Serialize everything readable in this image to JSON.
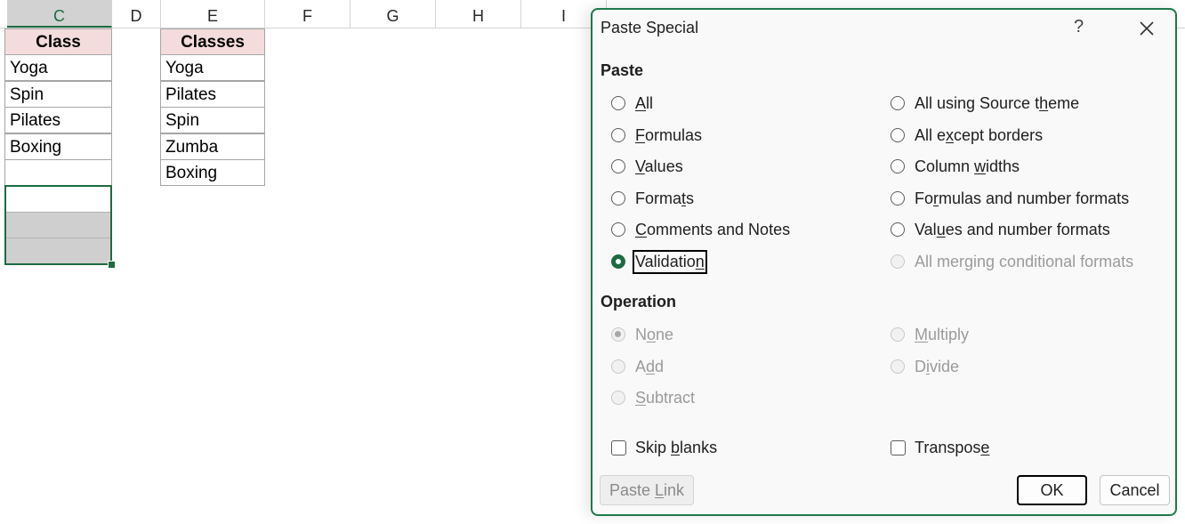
{
  "sheet": {
    "columns": [
      {
        "label": "C",
        "selected": true
      },
      {
        "label": "D",
        "selected": false
      },
      {
        "label": "E",
        "selected": false
      },
      {
        "label": "F",
        "selected": false
      },
      {
        "label": "G",
        "selected": false
      },
      {
        "label": "H",
        "selected": false
      },
      {
        "label": "I",
        "selected": false
      }
    ],
    "class_list": {
      "header": "Class",
      "items": [
        "Yoga",
        "Spin",
        "Pilates",
        "Boxing"
      ]
    },
    "classes_list": {
      "header": "Classes",
      "items": [
        "Yoga",
        "Pilates",
        "Spin",
        "Zumba",
        "Boxing"
      ]
    },
    "accent_color": "#1e6b41"
  },
  "dialog": {
    "title": "Paste Special",
    "help": "?",
    "paste_label": "Paste",
    "paste_options_left": [
      {
        "pre": "",
        "ul": "A",
        "post": "ll",
        "checked": false,
        "disabled": false
      },
      {
        "pre": "",
        "ul": "F",
        "post": "ormulas",
        "checked": false,
        "disabled": false
      },
      {
        "pre": "",
        "ul": "V",
        "post": "alues",
        "checked": false,
        "disabled": false
      },
      {
        "pre": "Forma",
        "ul": "t",
        "post": "s",
        "checked": false,
        "disabled": false
      },
      {
        "pre": "",
        "ul": "C",
        "post": "omments and Notes",
        "checked": false,
        "disabled": false
      },
      {
        "pre": "Validatio",
        "ul": "n",
        "post": "",
        "checked": true,
        "disabled": false
      }
    ],
    "paste_options_right": [
      {
        "pre": "All using Source t",
        "ul": "h",
        "post": "eme",
        "checked": false,
        "disabled": false
      },
      {
        "pre": "All e",
        "ul": "x",
        "post": "cept borders",
        "checked": false,
        "disabled": false
      },
      {
        "pre": "Column ",
        "ul": "w",
        "post": "idths",
        "checked": false,
        "disabled": false
      },
      {
        "pre": "Fo",
        "ul": "r",
        "post": "mulas and number formats",
        "checked": false,
        "disabled": false
      },
      {
        "pre": "Val",
        "ul": "u",
        "post": "es and number formats",
        "checked": false,
        "disabled": false
      },
      {
        "pre": "All mer",
        "ul": "g",
        "post": "ing conditional formats",
        "checked": false,
        "disabled": true
      }
    ],
    "operation_label": "Operation",
    "operation_left": [
      {
        "pre": "N",
        "ul": "o",
        "post": "ne",
        "checked": true,
        "disabled": true
      },
      {
        "pre": "A",
        "ul": "d",
        "post": "d",
        "checked": false,
        "disabled": true
      },
      {
        "pre": "",
        "ul": "S",
        "post": "ubtract",
        "checked": false,
        "disabled": true
      }
    ],
    "operation_right": [
      {
        "pre": "",
        "ul": "M",
        "post": "ultiply",
        "checked": false,
        "disabled": true
      },
      {
        "pre": "D",
        "ul": "i",
        "post": "vide",
        "checked": false,
        "disabled": true
      }
    ],
    "skip_blanks": {
      "pre": "Skip ",
      "ul": "b",
      "post": "lanks",
      "checked": false
    },
    "transpose": {
      "pre": "Transpos",
      "ul": "e",
      "post": "",
      "checked": false
    },
    "paste_link": {
      "pre": "Paste ",
      "ul": "L",
      "post": "ink"
    },
    "ok_label": "OK",
    "cancel_label": "Cancel"
  }
}
